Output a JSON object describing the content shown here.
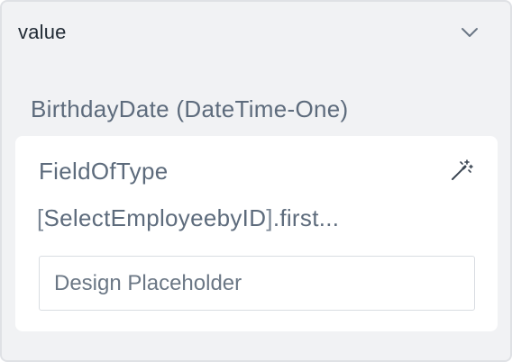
{
  "panel": {
    "title": "value",
    "collapse_icon": "chevron-down-icon"
  },
  "field": {
    "heading": "BirthdayDate (DateTime-One)",
    "label": "FieldOfType",
    "magic_icon": "magic-wand-icon",
    "expression_open": "[",
    "expression_name": "SelectEmployeebyID",
    "expression_close": "]",
    "expression_suffix": ".first...",
    "input_placeholder": "Design Placeholder",
    "input_value": ""
  },
  "colors": {
    "panel_bg": "#f1f2f4",
    "card_bg": "#ffffff",
    "text_muted": "#5d6b7c",
    "text_dark": "#1f2933"
  }
}
